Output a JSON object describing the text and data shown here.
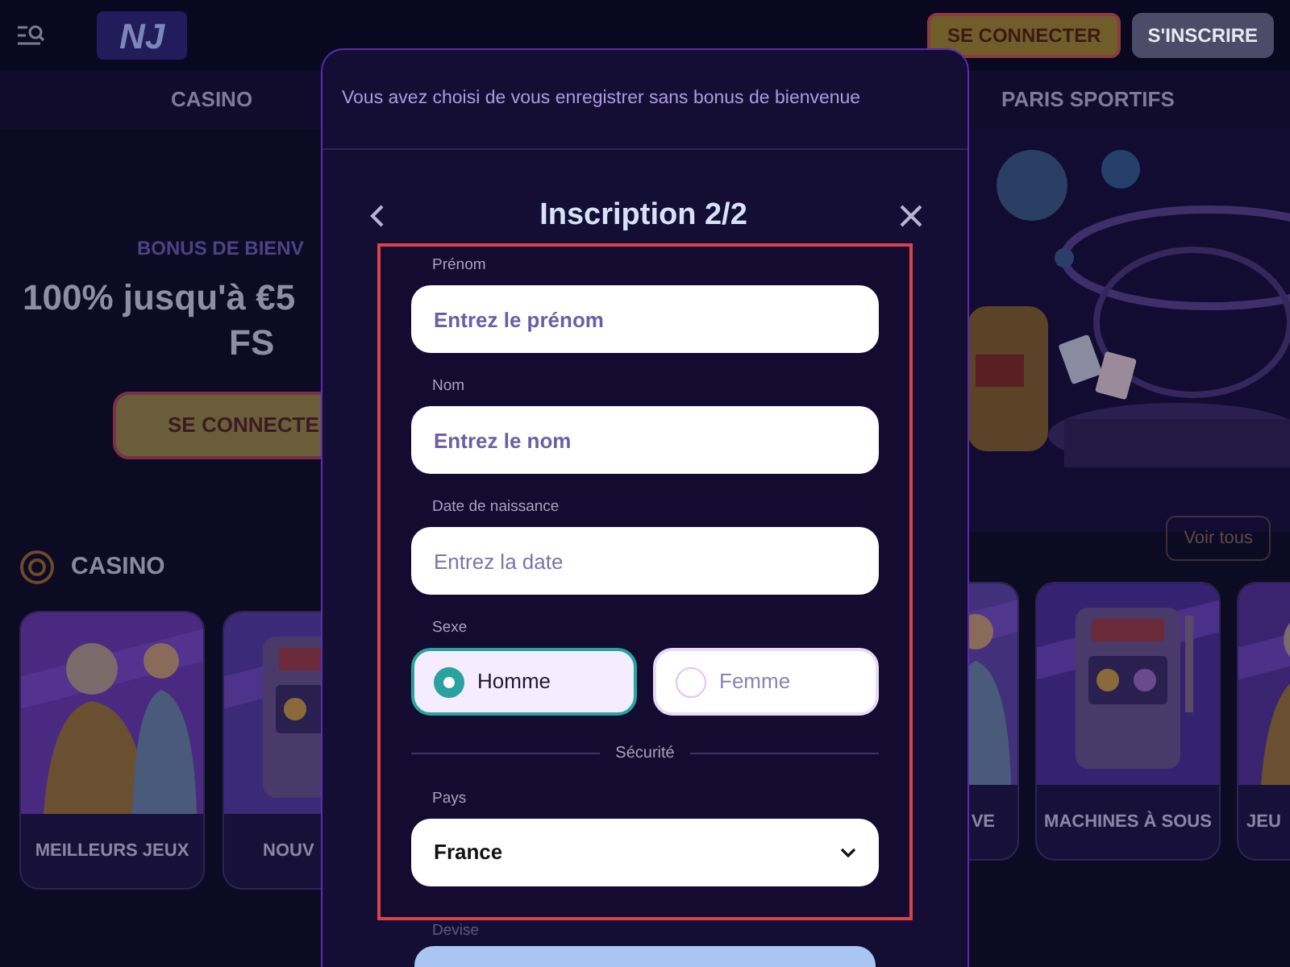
{
  "header": {
    "logo": "NJ",
    "buttons": [
      {
        "label": "SE CONNECTER",
        "kind": "login"
      },
      {
        "label": "S'INSCRIRE",
        "kind": "signup"
      }
    ]
  },
  "nav": {
    "left": "CASINO",
    "right": "PARIS SPORTIFS"
  },
  "hero": {
    "eyebrow": "BONUS DE BIENV",
    "headline": "100% jusqu'à €5",
    "headline_2": "FS",
    "button": "SE CONNECTE"
  },
  "casino": {
    "title": "CASINO",
    "see_all": "Voir tous",
    "left_cards": [
      {
        "label": "MEILLEURS JEUX"
      },
      {
        "label": "NOUV"
      }
    ],
    "right_cards": [
      {
        "label": "VE"
      },
      {
        "label": "MACHINES À SOUS"
      },
      {
        "label": "JEU"
      }
    ]
  },
  "modal": {
    "notice": "Vous avez choisi de vous enregistrer sans bonus de bienvenue",
    "title": "Inscription 2/2",
    "fields": [
      {
        "kind": "text",
        "label": "Prénom",
        "placeholder": "Entrez le prénom"
      },
      {
        "kind": "text",
        "label": "Nom",
        "placeholder": "Entrez le nom"
      },
      {
        "kind": "date",
        "label": "Date de naissance",
        "placeholder": "Entrez la date"
      },
      {
        "kind": "radio",
        "label": "Sexe",
        "options": [
          {
            "label": "Homme",
            "selected": true
          },
          {
            "label": "Femme",
            "selected": false
          }
        ]
      },
      {
        "kind": "divider",
        "label": "Sécurité"
      },
      {
        "kind": "select",
        "label": "Pays",
        "value": "France"
      }
    ],
    "next_label": "Devise"
  }
}
